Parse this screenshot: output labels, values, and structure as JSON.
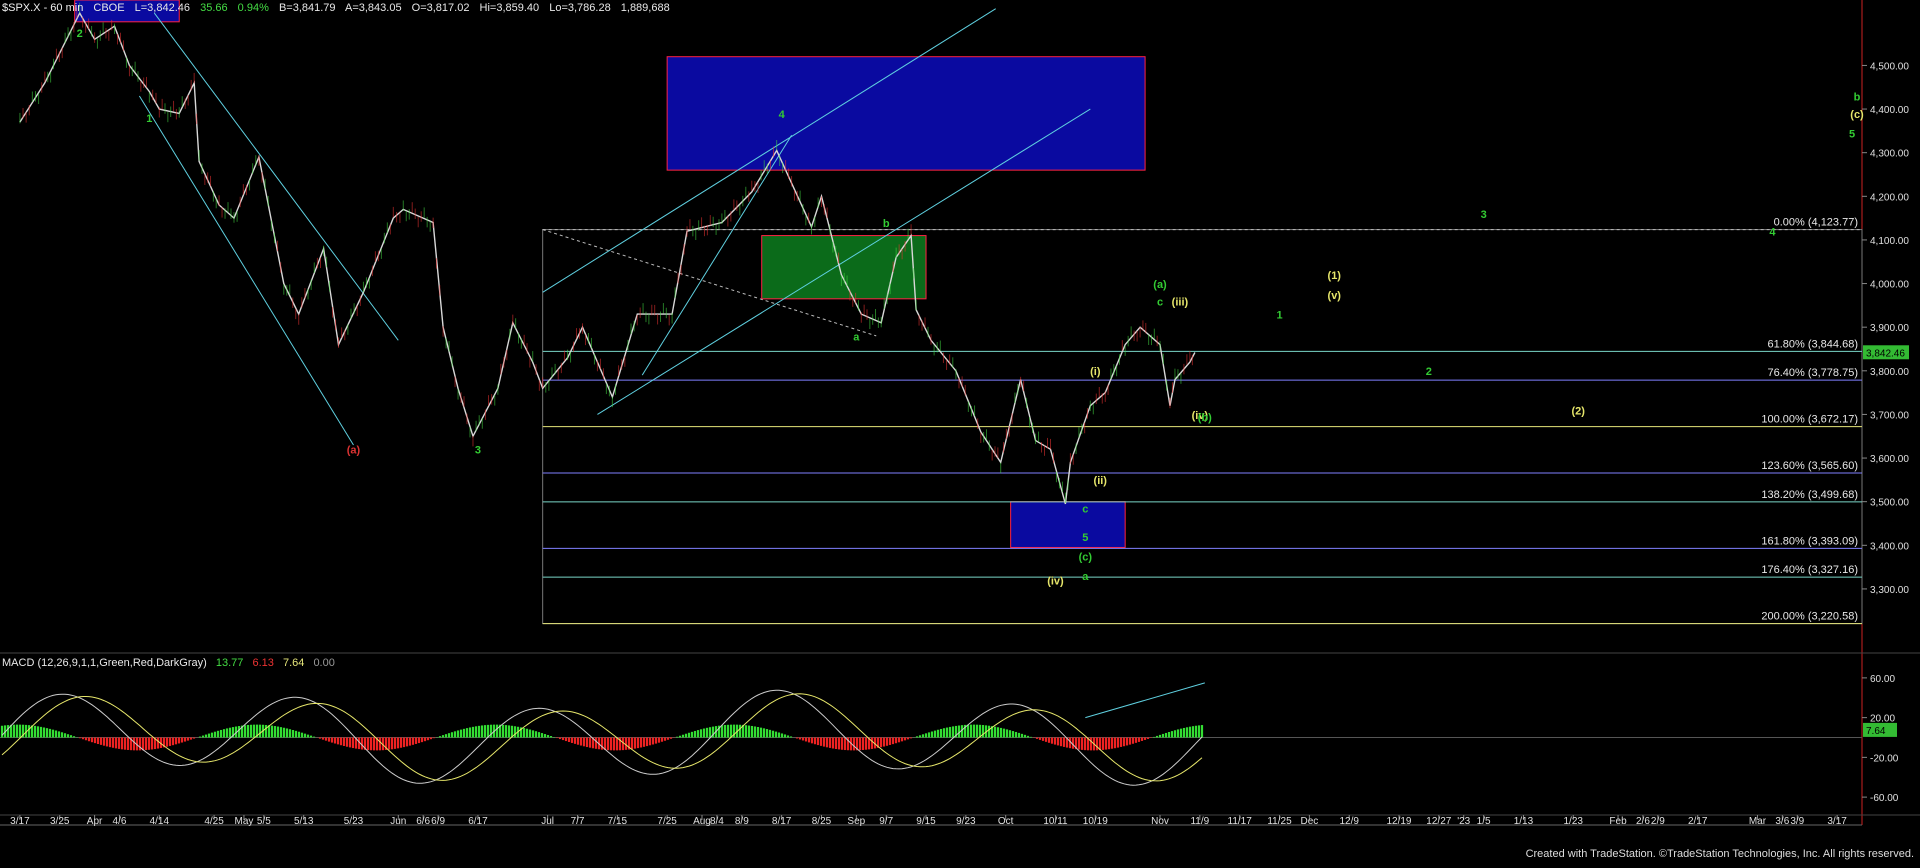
{
  "header": {
    "symbol": "$SPX.X - 60 min",
    "exchange": "CBOE",
    "last": "L=3,842.46",
    "change": "35.66",
    "change_pct": "0.94%",
    "bid": "B=3,841.79",
    "ask": "A=3,843.05",
    "open": "O=3,817.02",
    "high": "Hi=3,859.40",
    "low": "Lo=3,786.28",
    "volume": "1,889,688"
  },
  "macd_header": {
    "label": "MACD (12,26,9,1,1,Green,Red,DarkGray)",
    "v1": "13.77",
    "v2": "6.13",
    "v3": "7.64",
    "v4": "0.00"
  },
  "footer": "Created with TradeStation. ©TradeStation Technologies, Inc. All rights reserved.",
  "colors": {
    "background": "#000000",
    "bar": "#d8d8d8",
    "up_bar": "#44dd44",
    "down_bar": "#ee3333",
    "fib_yellow": "#e6e67a",
    "fib_blue": "#8080ff",
    "fib_teal": "#7ad6c8",
    "target_box_blue": "#0a0aa0",
    "target_box_green": "#0b6b1a",
    "box_border_red": "#ff2244",
    "channel": "#5fd0e0",
    "label_green": "#33cc33",
    "label_yellow": "#e6e66a",
    "label_red": "#dd3333",
    "last_price_bg": "#33bb33",
    "macd_hist_pos": "#33dd33",
    "macd_hist_neg": "#ee2222"
  },
  "chart_data": {
    "type": "line",
    "title": "$SPX.X - 60 min",
    "ylabel": "",
    "xlabel": "",
    "ylim": [
      3160,
      4650
    ],
    "y_ticks": [
      "4,500.00",
      "4,400.00",
      "4,300.00",
      "4,200.00",
      "4,100.00",
      "4,000.00",
      "3,900.00",
      "3,800.00",
      "3,700.00",
      "3,600.00",
      "3,500.00",
      "3,400.00",
      "3,300.00"
    ],
    "last_price_tag": "3,842.46",
    "x_ticks": [
      "3/17",
      "3/25",
      "Apr",
      "4/6",
      "4/14",
      "4/25",
      "May",
      "5/5",
      "5/13",
      "5/23",
      "Jun",
      "6/6",
      "6/9",
      "6/17",
      "Jul",
      "7/7",
      "7/15",
      "7/25",
      "Aug",
      "8/4",
      "8/9",
      "8/17",
      "8/25",
      "Sep",
      "9/7",
      "9/15",
      "9/23",
      "Oct",
      "10/11",
      "10/19",
      "Nov",
      "11/9",
      "11/17",
      "11/25",
      "Dec",
      "12/9",
      "12/19",
      "12/27",
      "'23",
      "1/5",
      "1/13",
      "1/23",
      "Feb",
      "2/6",
      "2/9",
      "2/17",
      "Mar",
      "3/6",
      "3/9",
      "3/17"
    ],
    "price_series": [
      {
        "d": "2022-03-17",
        "v": 4370
      },
      {
        "d": "2022-03-22",
        "v": 4460
      },
      {
        "d": "2022-03-29",
        "v": 4620
      },
      {
        "d": "2022-04-01",
        "v": 4560
      },
      {
        "d": "2022-04-05",
        "v": 4590
      },
      {
        "d": "2022-04-08",
        "v": 4500
      },
      {
        "d": "2022-04-12",
        "v": 4440
      },
      {
        "d": "2022-04-14",
        "v": 4400
      },
      {
        "d": "2022-04-18",
        "v": 4390
      },
      {
        "d": "2022-04-21",
        "v": 4460
      },
      {
        "d": "2022-04-22",
        "v": 4280
      },
      {
        "d": "2022-04-26",
        "v": 4180
      },
      {
        "d": "2022-04-29",
        "v": 4150
      },
      {
        "d": "2022-05-04",
        "v": 4290
      },
      {
        "d": "2022-05-09",
        "v": 4000
      },
      {
        "d": "2022-05-12",
        "v": 3930
      },
      {
        "d": "2022-05-17",
        "v": 4080
      },
      {
        "d": "2022-05-20",
        "v": 3860
      },
      {
        "d": "2022-05-25",
        "v": 3980
      },
      {
        "d": "2022-05-31",
        "v": 4150
      },
      {
        "d": "2022-06-02",
        "v": 4170
      },
      {
        "d": "2022-06-08",
        "v": 4140
      },
      {
        "d": "2022-06-10",
        "v": 3900
      },
      {
        "d": "2022-06-13",
        "v": 3760
      },
      {
        "d": "2022-06-16",
        "v": 3650
      },
      {
        "d": "2022-06-21",
        "v": 3760
      },
      {
        "d": "2022-06-24",
        "v": 3910
      },
      {
        "d": "2022-06-28",
        "v": 3820
      },
      {
        "d": "2022-06-30",
        "v": 3760
      },
      {
        "d": "2022-07-05",
        "v": 3830
      },
      {
        "d": "2022-07-08",
        "v": 3900
      },
      {
        "d": "2022-07-14",
        "v": 3740
      },
      {
        "d": "2022-07-19",
        "v": 3930
      },
      {
        "d": "2022-07-26",
        "v": 3930
      },
      {
        "d": "2022-07-29",
        "v": 4120
      },
      {
        "d": "2022-08-05",
        "v": 4140
      },
      {
        "d": "2022-08-11",
        "v": 4210
      },
      {
        "d": "2022-08-16",
        "v": 4305
      },
      {
        "d": "2022-08-19",
        "v": 4230
      },
      {
        "d": "2022-08-23",
        "v": 4130
      },
      {
        "d": "2022-08-25",
        "v": 4200
      },
      {
        "d": "2022-08-29",
        "v": 4020
      },
      {
        "d": "2022-09-02",
        "v": 3930
      },
      {
        "d": "2022-09-06",
        "v": 3910
      },
      {
        "d": "2022-09-09",
        "v": 4060
      },
      {
        "d": "2022-09-12",
        "v": 4110
      },
      {
        "d": "2022-09-13",
        "v": 3940
      },
      {
        "d": "2022-09-16",
        "v": 3870
      },
      {
        "d": "2022-09-21",
        "v": 3800
      },
      {
        "d": "2022-09-26",
        "v": 3660
      },
      {
        "d": "2022-09-30",
        "v": 3590
      },
      {
        "d": "2022-10-04",
        "v": 3780
      },
      {
        "d": "2022-10-07",
        "v": 3640
      },
      {
        "d": "2022-10-10",
        "v": 3620
      },
      {
        "d": "2022-10-13",
        "v": 3495
      },
      {
        "d": "2022-10-14",
        "v": 3590
      },
      {
        "d": "2022-10-18",
        "v": 3720
      },
      {
        "d": "2022-10-21",
        "v": 3750
      },
      {
        "d": "2022-10-25",
        "v": 3860
      },
      {
        "d": "2022-10-28",
        "v": 3900
      },
      {
        "d": "2022-11-01",
        "v": 3860
      },
      {
        "d": "2022-11-03",
        "v": 3720
      },
      {
        "d": "2022-11-04",
        "v": 3780
      },
      {
        "d": "2022-11-07",
        "v": 3820
      },
      {
        "d": "2022-11-08",
        "v": 3842
      }
    ],
    "macd_axis": {
      "ylim": [
        -78,
        78
      ],
      "y_ticks": [
        "60.00",
        "20.00",
        "-20.00",
        "-60.00"
      ],
      "last_value_tag": "7.64",
      "histogram_hint": "alternating green/red histogram with two oscillating lines"
    },
    "fib_levels": [
      {
        "label": "0.00% (4,123.77)",
        "value": 4123.77,
        "color": "dotted"
      },
      {
        "label": "61.80% (3,844.68)",
        "value": 3844.68,
        "color": "teal"
      },
      {
        "label": "76.40% (3,778.75)",
        "value": 3778.75,
        "color": "blue"
      },
      {
        "label": "100.00% (3,672.17)",
        "value": 3672.17,
        "color": "yellow"
      },
      {
        "label": "123.60% (3,565.60)",
        "value": 3565.6,
        "color": "blue"
      },
      {
        "label": "138.20% (3,499.68)",
        "value": 3499.68,
        "color": "teal"
      },
      {
        "label": "161.80% (3,393.09)",
        "value": 3393.09,
        "color": "blue"
      },
      {
        "label": "176.40% (3,327.16)",
        "value": 3327.16,
        "color": "teal"
      },
      {
        "label": "200.00% (3,220.58)",
        "value": 3220.58,
        "color": "yellow"
      }
    ],
    "annotations": [
      {
        "text": "2",
        "d": "2022-03-29",
        "v": 4565,
        "c": "green"
      },
      {
        "text": "1",
        "d": "2022-04-12",
        "v": 4370,
        "c": "green"
      },
      {
        "text": "(a)",
        "d": "2022-05-23",
        "v": 3610,
        "c": "red"
      },
      {
        "text": "3",
        "d": "2022-06-17",
        "v": 3610,
        "c": "green"
      },
      {
        "text": "4",
        "d": "2022-08-17",
        "v": 4380,
        "c": "green"
      },
      {
        "text": "b",
        "d": "2022-09-07",
        "v": 4130,
        "c": "green"
      },
      {
        "text": "a",
        "d": "2022-09-01",
        "v": 3870,
        "c": "green"
      },
      {
        "text": "(a)",
        "d": "2022-11-01",
        "v": 3990,
        "c": "green"
      },
      {
        "text": "c",
        "d": "2022-11-01",
        "v": 3950,
        "c": "green"
      },
      {
        "text": "(iii)",
        "d": "2022-11-05",
        "v": 3950,
        "c": "yellow"
      },
      {
        "text": "(i)",
        "d": "2022-10-19",
        "v": 3790,
        "c": "yellow"
      },
      {
        "text": "(ii)",
        "d": "2022-10-20",
        "v": 3540,
        "c": "yellow"
      },
      {
        "text": "c",
        "d": "2022-10-17",
        "v": 3475,
        "c": "green"
      },
      {
        "text": "5",
        "d": "2022-10-17",
        "v": 3410,
        "c": "green"
      },
      {
        "text": "(c)",
        "d": "2022-10-17",
        "v": 3365,
        "c": "green"
      },
      {
        "text": "(iv)",
        "d": "2022-10-11",
        "v": 3310,
        "c": "yellow"
      },
      {
        "text": "a",
        "d": "2022-10-17",
        "v": 3320,
        "c": "green"
      },
      {
        "text": "(iv)",
        "d": "2022-11-09",
        "v": 3690,
        "c": "yellow"
      },
      {
        "text": "(b)",
        "d": "2022-11-10",
        "v": 3685,
        "c": "green"
      },
      {
        "text": "1",
        "d": "2022-11-25",
        "v": 3920,
        "c": "green"
      },
      {
        "text": "(1)",
        "d": "2022-12-06",
        "v": 4010,
        "c": "yellow"
      },
      {
        "text": "(v)",
        "d": "2022-12-06",
        "v": 3965,
        "c": "yellow"
      },
      {
        "text": "2",
        "d": "2022-12-25",
        "v": 3790,
        "c": "green"
      },
      {
        "text": "3",
        "d": "2023-01-05",
        "v": 4150,
        "c": "green"
      },
      {
        "text": "(2)",
        "d": "2023-01-24",
        "v": 3700,
        "c": "yellow"
      },
      {
        "text": "4",
        "d": "2023-03-04",
        "v": 4110,
        "c": "green"
      },
      {
        "text": "b",
        "d": "2023-03-21",
        "v": 4420,
        "c": "green"
      },
      {
        "text": "(c)",
        "d": "2023-03-21",
        "v": 4380,
        "c": "yellow"
      },
      {
        "text": "5",
        "d": "2023-03-20",
        "v": 4335,
        "c": "green"
      }
    ],
    "grid": false,
    "legend": "none"
  }
}
